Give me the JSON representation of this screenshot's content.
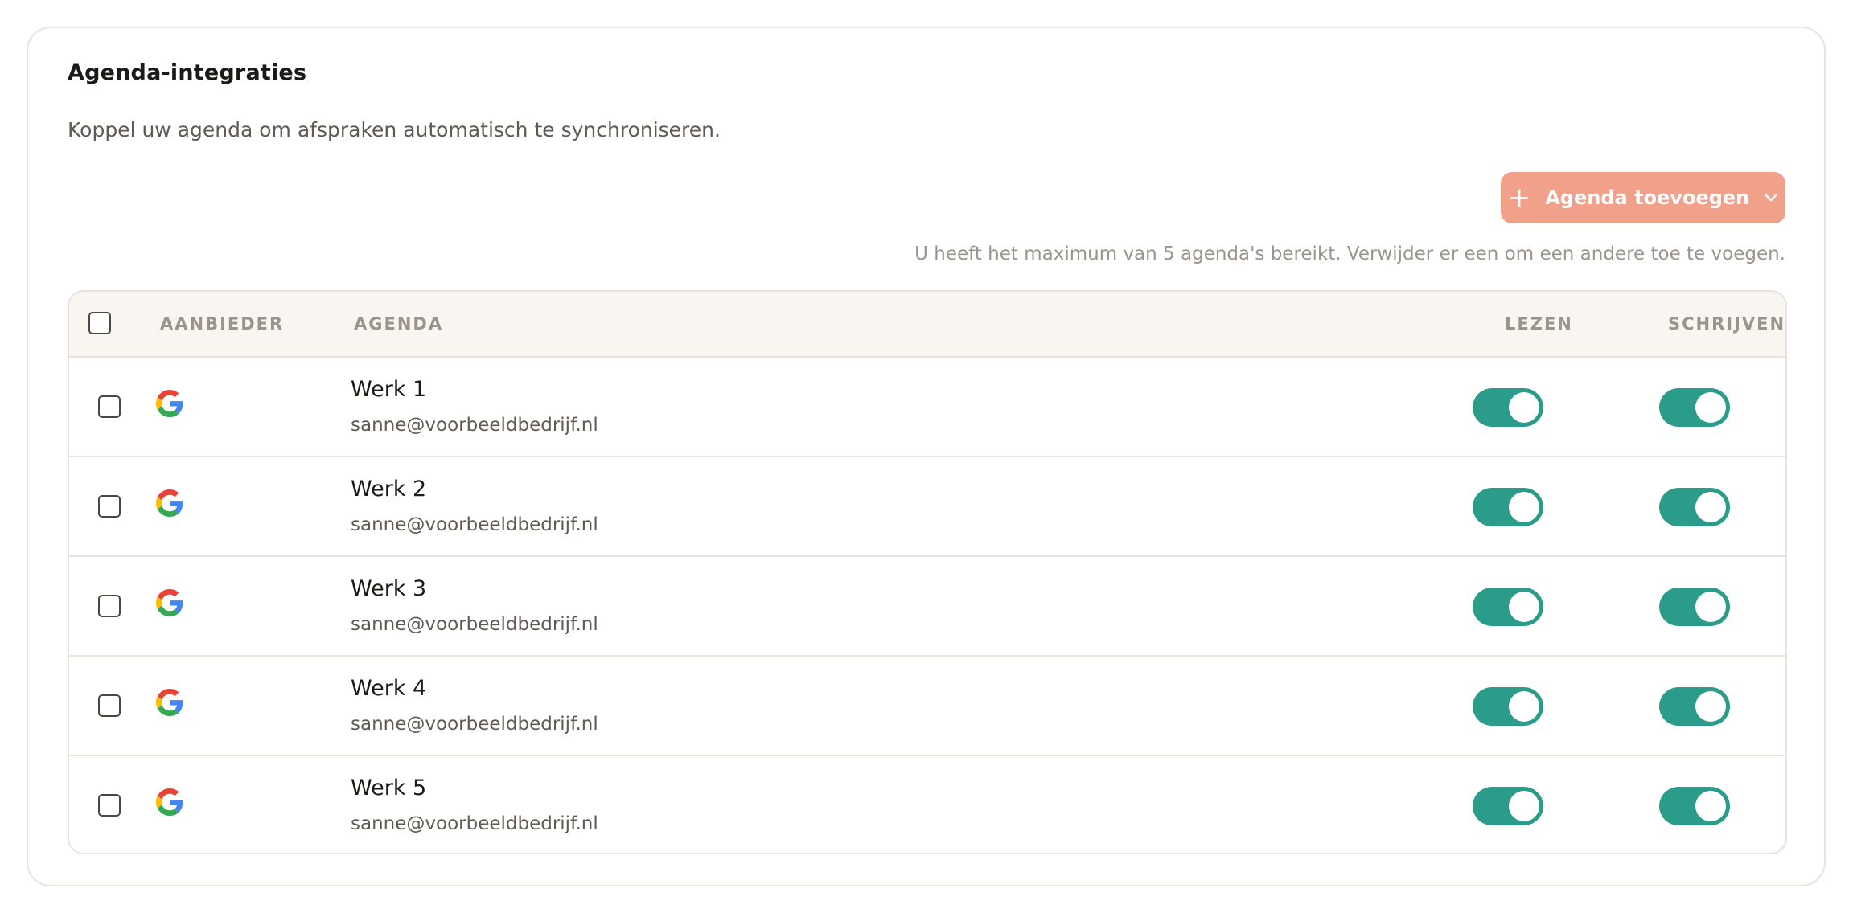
{
  "section": {
    "title": "Agenda-integraties",
    "description": "Koppel uw agenda om afspraken automatisch te synchroniseren.",
    "add_button_label": "Agenda toevoegen",
    "limit_note": "U heeft het maximum van 5 agenda's bereikt. Verwijder er een om een andere toe te voegen."
  },
  "table": {
    "columns": {
      "provider": "AANBIEDER",
      "calendar": "AGENDA",
      "read": "LEZEN",
      "write": "SCHRIJVEN"
    },
    "rows": [
      {
        "provider_icon": "google-icon",
        "name": "Werk 1",
        "email": "sanne@voorbeeldbedrijf.nl",
        "checked": false,
        "read": true,
        "write": true
      },
      {
        "provider_icon": "google-icon",
        "name": "Werk 2",
        "email": "sanne@voorbeeldbedrijf.nl",
        "checked": false,
        "read": true,
        "write": true
      },
      {
        "provider_icon": "google-icon",
        "name": "Werk 3",
        "email": "sanne@voorbeeldbedrijf.nl",
        "checked": false,
        "read": true,
        "write": true
      },
      {
        "provider_icon": "google-icon",
        "name": "Werk 4",
        "email": "sanne@voorbeeldbedrijf.nl",
        "checked": false,
        "read": true,
        "write": true
      },
      {
        "provider_icon": "google-icon",
        "name": "Werk 5",
        "email": "sanne@voorbeeldbedrijf.nl",
        "checked": false,
        "read": true,
        "write": true
      }
    ]
  },
  "colors": {
    "accent_button": "#f1a08a",
    "toggle_on": "#2b9c89",
    "header_bg": "#f9f6f2",
    "border": "#e7e4df"
  }
}
